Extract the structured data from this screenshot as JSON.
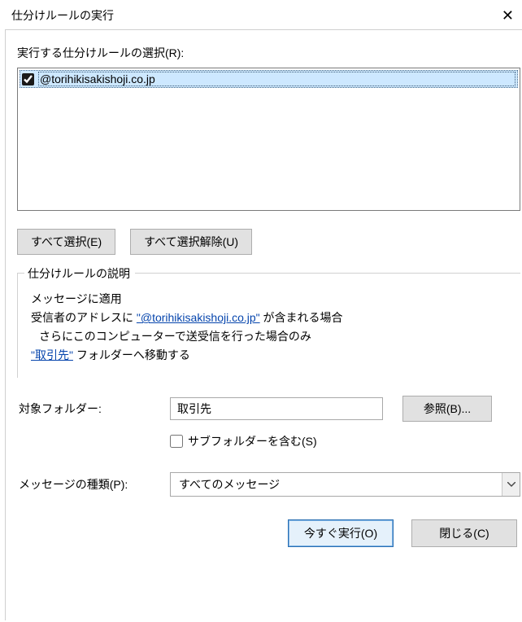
{
  "title": "仕分けルールの実行",
  "close_glyph": "✕",
  "select_label": "実行する仕分けルールの選択(R):",
  "rules": [
    {
      "checked": true,
      "name": "@torihikisakishoji.co.jp"
    }
  ],
  "buttons": {
    "select_all": "すべて選択(E)",
    "deselect_all": "すべて選択解除(U)",
    "browse": "参照(B)...",
    "run_now": "今すぐ実行(O)",
    "close": "閉じる(C)"
  },
  "description": {
    "group_title": "仕分けルールの説明",
    "line1": "メッセージに適用",
    "line2_pre": "受信者のアドレスに ",
    "line2_link": "\"@torihikisakishoji.co.jp\"",
    "line2_post": " が含まれる場合",
    "line3": "さらにこのコンピューターで送受信を行った場合のみ",
    "line4_link": "\"取引先\"",
    "line4_post": " フォルダーへ移動する"
  },
  "target_folder": {
    "label": "対象フォルダー:",
    "value": "取引先"
  },
  "subfolder_checkbox": {
    "checked": false,
    "label": "サブフォルダーを含む(S)"
  },
  "message_type": {
    "label": "メッセージの種類(P):",
    "value": "すべてのメッセージ"
  }
}
